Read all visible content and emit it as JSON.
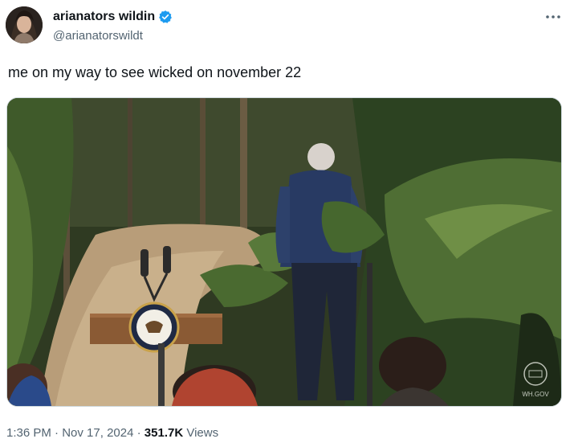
{
  "author": {
    "display_name": "arianators wildin",
    "handle": "@arianatorswildt",
    "verified": true
  },
  "tweet": {
    "text": "me on my way to see wicked on november 22"
  },
  "media": {
    "watermark": "WH.GOV"
  },
  "meta": {
    "time": "1:36 PM",
    "separator": "·",
    "date": "Nov 17, 2024",
    "views_count": "351.7K",
    "views_label": "Views"
  },
  "icons": {
    "more": "more-options-icon",
    "verified": "verified-badge-icon"
  },
  "colors": {
    "verified_blue": "#1d9bf0",
    "text_primary": "#0f1419",
    "text_secondary": "#536471"
  }
}
